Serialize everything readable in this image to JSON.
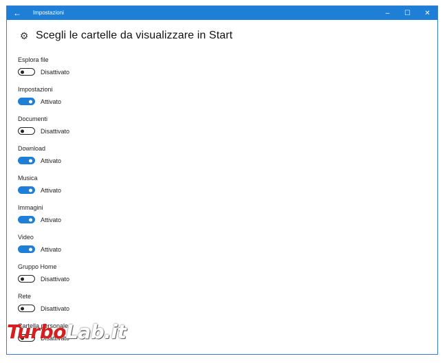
{
  "window": {
    "title": "Impostazioni",
    "back_icon": "back-arrow-icon",
    "controls": {
      "minimize": "–",
      "maximize": "☐",
      "close": "✕"
    },
    "accent": "#1f7fd6"
  },
  "header": {
    "icon": "gear-icon",
    "title": "Scegli le cartelle da visualizzare in Start"
  },
  "settings": [
    {
      "label": "Esplora file",
      "on": false,
      "state": "Disattivato"
    },
    {
      "label": "Impostazioni",
      "on": true,
      "state": "Attivato"
    },
    {
      "label": "Documenti",
      "on": false,
      "state": "Disattivato"
    },
    {
      "label": "Download",
      "on": true,
      "state": "Attivato"
    },
    {
      "label": "Musica",
      "on": true,
      "state": "Attivato"
    },
    {
      "label": "Immagini",
      "on": true,
      "state": "Attivato"
    },
    {
      "label": "Video",
      "on": true,
      "state": "Attivato"
    },
    {
      "label": "Gruppo Home",
      "on": false,
      "state": "Disattivato"
    },
    {
      "label": "Rete",
      "on": false,
      "state": "Disattivato"
    },
    {
      "label": "Cartella personale",
      "on": false,
      "state": "Disattivato"
    }
  ],
  "watermark": {
    "part1": "Turbo",
    "part2": "Lab.it"
  }
}
